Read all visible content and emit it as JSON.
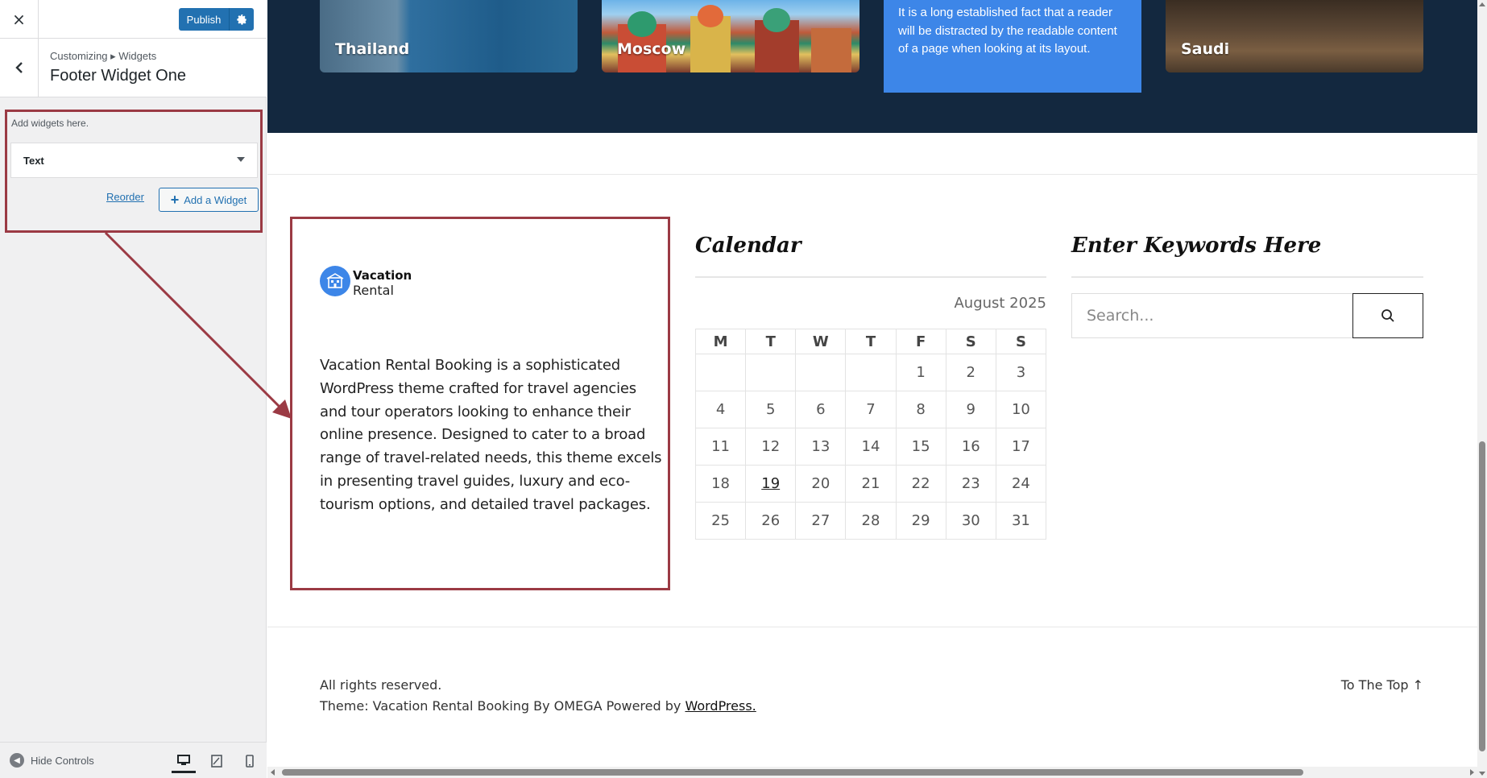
{
  "customizer": {
    "close_label": "×",
    "publish_label": "Publish",
    "breadcrumb": "Customizing ▸ Widgets",
    "section_title": "Footer Widget One",
    "add_widgets_hint": "Add widgets here.",
    "widgets": [
      {
        "title": "Text"
      }
    ],
    "reorder_label": "Reorder",
    "add_widget_label": "Add a Widget",
    "hide_controls_label": "Hide Controls",
    "devices": [
      "desktop-icon",
      "tablet-icon",
      "mobile-icon"
    ],
    "accent_color": "#2271b1",
    "highlight_color": "#9b3a44"
  },
  "preview": {
    "destinations": [
      {
        "name": "Thailand"
      },
      {
        "name": "Moscow"
      },
      {
        "text": "It is a long established fact that a reader will be distracted by the readable content of a page when looking at its layout."
      },
      {
        "name": "Saudi"
      }
    ],
    "footer_widget_one": {
      "logo_title": "Vacation",
      "logo_subtitle": "Rental",
      "text": "Vacation Rental Booking is a sophisticated WordPress theme crafted for travel agencies and tour operators looking to enhance their online presence. Designed to cater to a broad range of travel-related needs, this theme excels in presenting travel guides, luxury and eco-tourism options, and detailed travel packages."
    },
    "calendar": {
      "heading": "Calendar",
      "caption": "August 2025",
      "weekdays": [
        "M",
        "T",
        "W",
        "T",
        "F",
        "S",
        "S"
      ],
      "weeks": [
        [
          "",
          "",
          "",
          "",
          "1",
          "2",
          "3"
        ],
        [
          "4",
          "5",
          "6",
          "7",
          "8",
          "9",
          "10"
        ],
        [
          "11",
          "12",
          "13",
          "14",
          "15",
          "16",
          "17"
        ],
        [
          "18",
          "19",
          "20",
          "21",
          "22",
          "23",
          "24"
        ],
        [
          "25",
          "26",
          "27",
          "28",
          "29",
          "30",
          "31"
        ]
      ],
      "today": "19"
    },
    "search": {
      "heading": "Enter Keywords Here",
      "placeholder": "Search..."
    },
    "footer": {
      "copyright": "All rights reserved.",
      "credit_prefix": "Theme: Vacation Rental Booking By OMEGA Powered by ",
      "credit_link": "WordPress.",
      "to_top": "To The Top ↑"
    },
    "band_color": "#13283f",
    "card_blue": "#3d86e8"
  }
}
